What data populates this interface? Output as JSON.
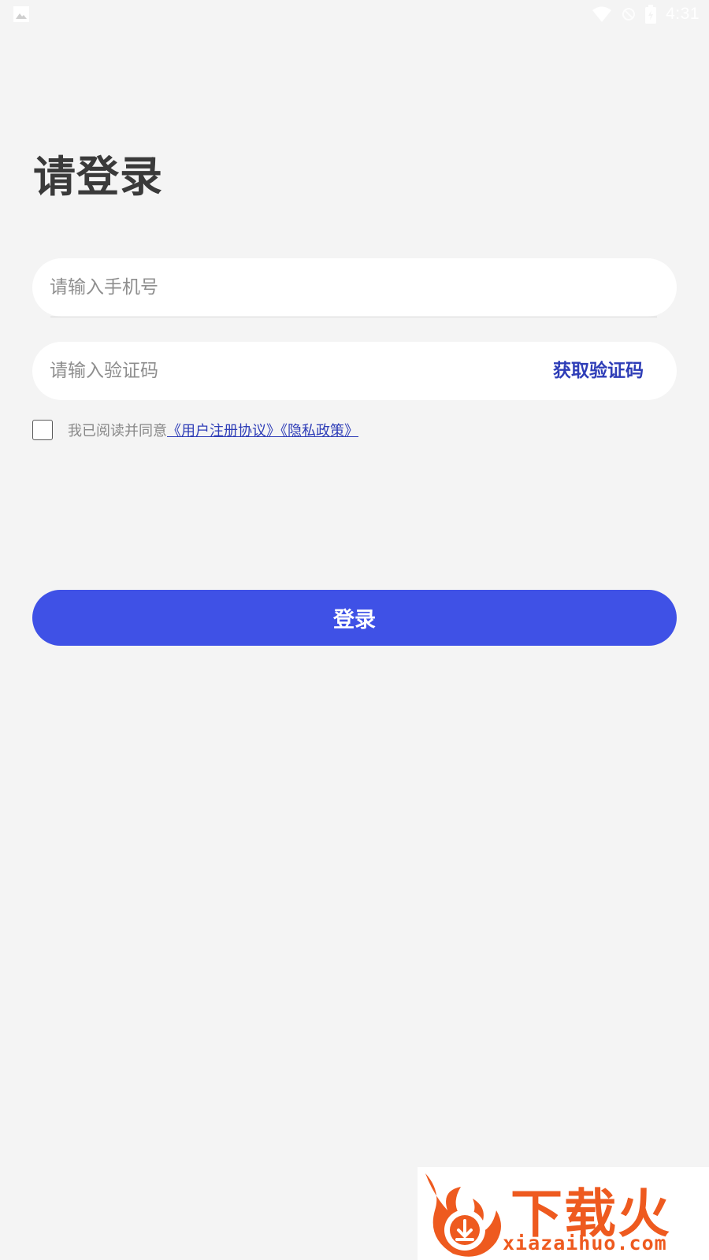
{
  "status_bar": {
    "time": "4:31",
    "icons": [
      "image-icon",
      "wifi-icon",
      "no-sim-icon",
      "battery-icon"
    ]
  },
  "login": {
    "title": "请登录",
    "phone_placeholder": "请输入手机号",
    "code_placeholder": "请输入验证码",
    "get_code_label": "获取验证码",
    "agree_prefix": "我已阅读并同意",
    "agree_links": "《用户注册协议》《隐私政策》",
    "submit_label": "登录"
  },
  "colors": {
    "background": "#f4f4f4",
    "accent": "#3f51e6",
    "link": "#2e3db7",
    "watermark": "#ee5a1f"
  },
  "watermark": {
    "brand": "下载火",
    "url": "xiazaihuo.com"
  }
}
